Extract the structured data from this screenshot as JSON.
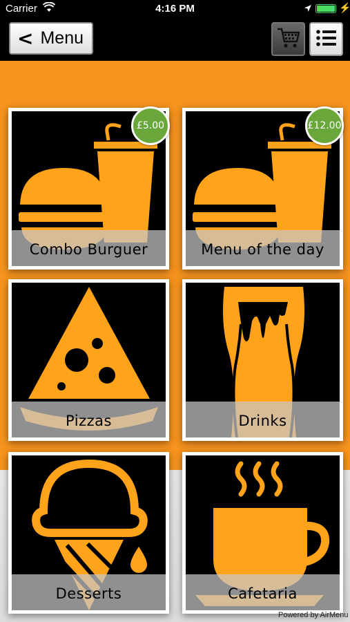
{
  "status_bar": {
    "carrier": "Carrier",
    "time": "4:16 PM"
  },
  "nav": {
    "back_label": "Menu",
    "back_chevron": "<",
    "cart_icon": "shopping-cart-icon",
    "list_icon": "list-view-icon"
  },
  "tiles": [
    {
      "label": "Combo Burguer",
      "price": "£5.00",
      "icon": "burger-and-drink-icon"
    },
    {
      "label": "Menu of the day",
      "price": "£12.00",
      "icon": "burger-and-drink-icon"
    },
    {
      "label": "Pizzas",
      "icon": "pizza-slice-icon"
    },
    {
      "label": "Drinks",
      "icon": "beer-glass-icon"
    },
    {
      "label": "Desserts",
      "icon": "ice-cream-cone-icon"
    },
    {
      "label": "Cafetaria",
      "icon": "coffee-cup-icon"
    }
  ],
  "footer": {
    "powered_by": "Powered by AirMenu"
  },
  "colors": {
    "accent": "#f7931e",
    "icon": "#ffa31a",
    "badge": "#6aa73a"
  }
}
